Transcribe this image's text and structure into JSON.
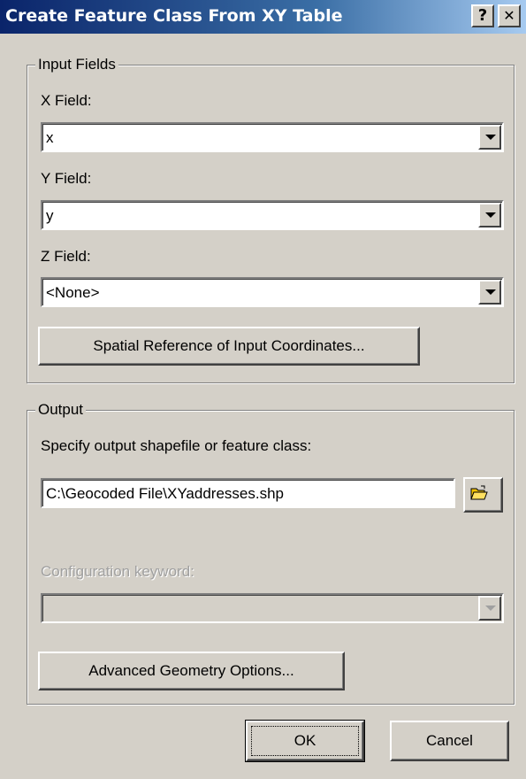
{
  "window": {
    "title": "Create Feature Class From XY Table",
    "help_label": "?",
    "close_label": "✕"
  },
  "input_fields": {
    "legend": "Input Fields",
    "x_label": "X Field:",
    "x_value": "x",
    "y_label": "Y Field:",
    "y_value": "y",
    "z_label": "Z Field:",
    "z_value": "<None>",
    "spatial_ref_button": "Spatial Reference of Input Coordinates..."
  },
  "output": {
    "legend": "Output",
    "specify_label": "Specify output shapefile or feature class:",
    "path_value": "C:\\Geocoded File\\XYaddresses.shp",
    "browse_icon": "open-folder-icon",
    "config_label": "Configuration keyword:",
    "config_value": "",
    "advanced_button": "Advanced Geometry Options..."
  },
  "footer": {
    "ok_label": "OK",
    "cancel_label": "Cancel"
  },
  "colors": {
    "dialog_face": "#d4d0c8",
    "titlebar_start": "#0a246a",
    "titlebar_end": "#a6caf0",
    "disabled_text": "#a0a0a0"
  }
}
